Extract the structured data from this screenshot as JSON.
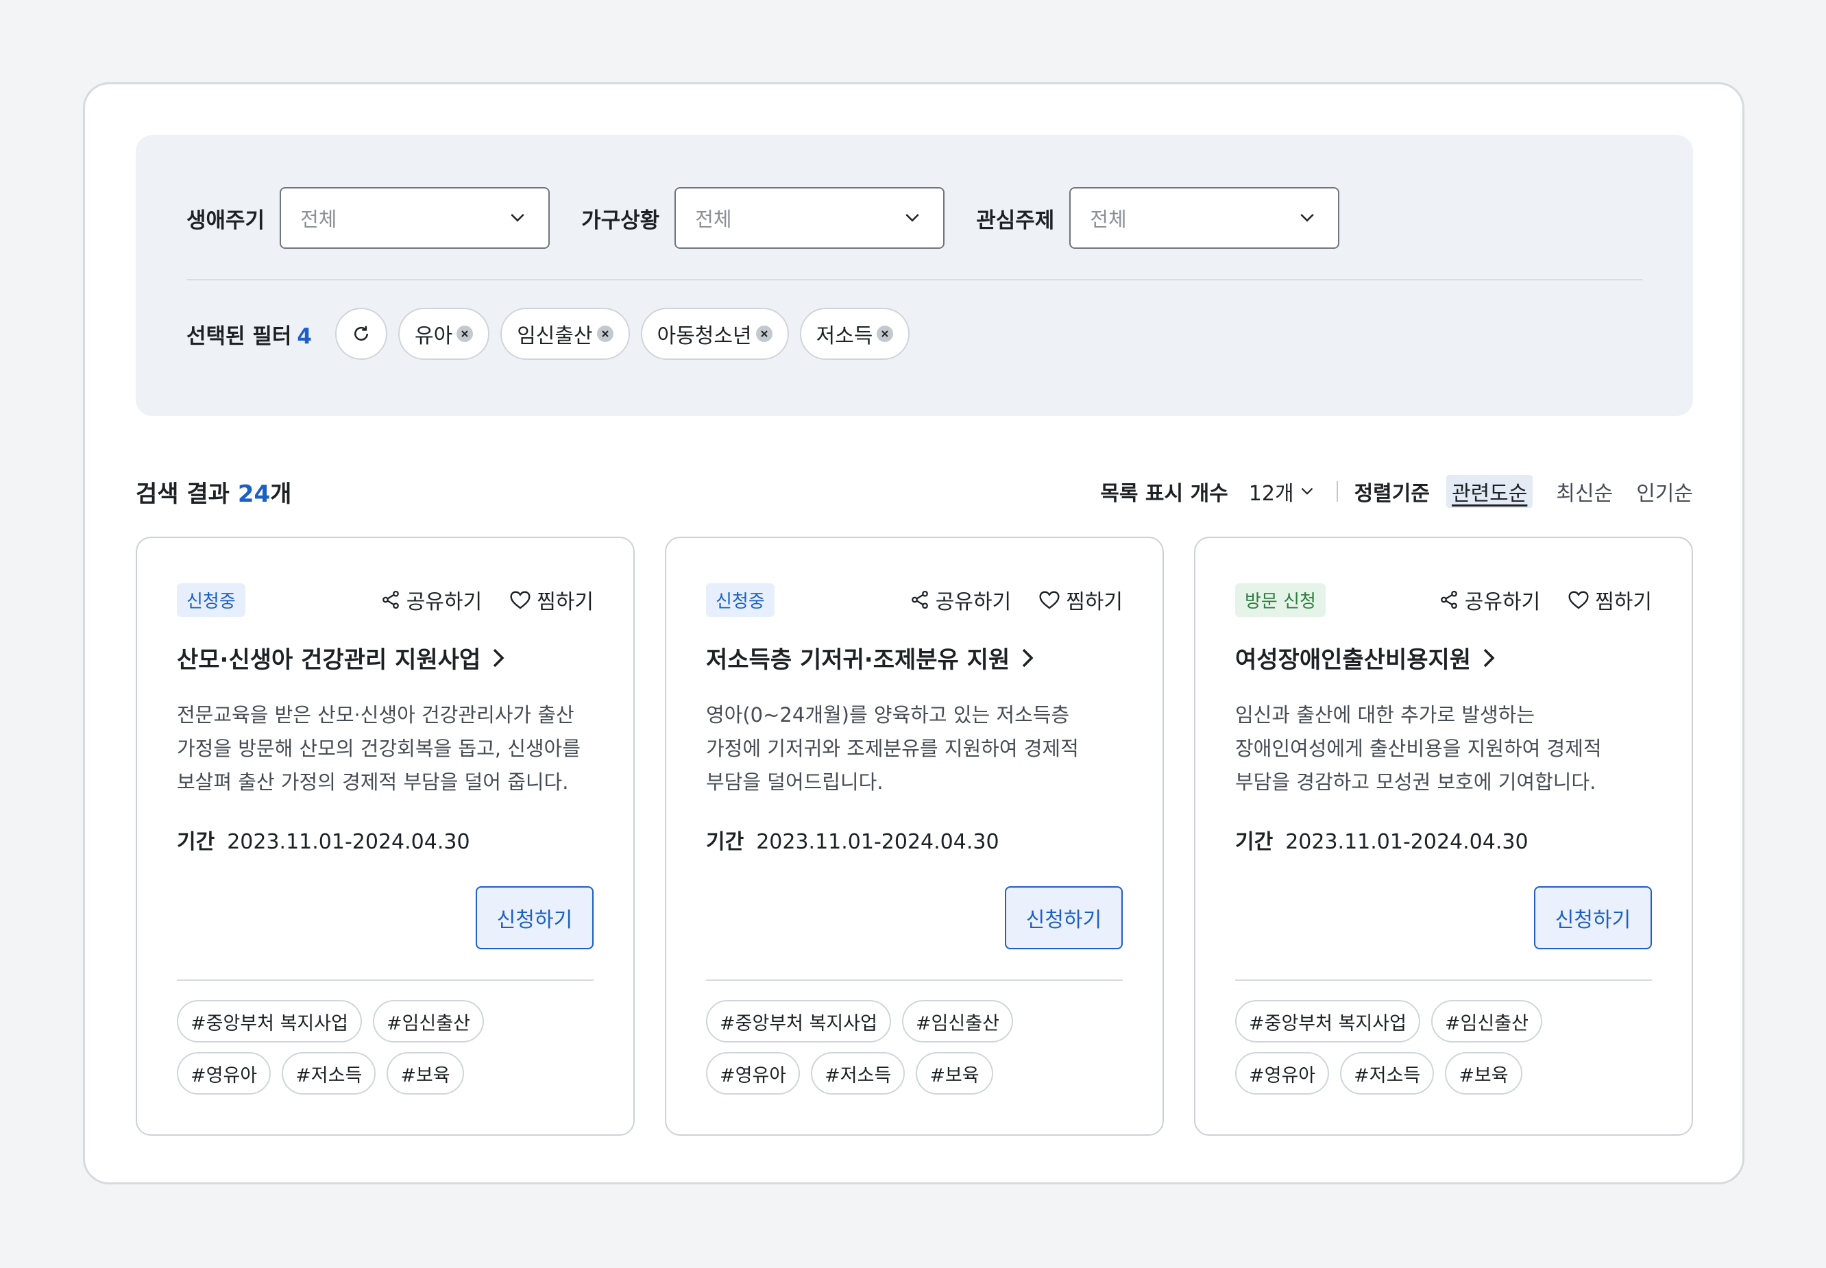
{
  "filters": {
    "groups": [
      {
        "label": "생애주기",
        "value": "전체"
      },
      {
        "label": "가구상황",
        "value": "전체"
      },
      {
        "label": "관심주제",
        "value": "전체"
      }
    ],
    "selected_label": "선택된 필터",
    "selected_count": "4",
    "chips": [
      "유아",
      "임신출산",
      "아동청소년",
      "저소득"
    ]
  },
  "results": {
    "prefix": "검색 결과",
    "count": "24",
    "suffix": "개",
    "per_page_label": "목록 표시 개수",
    "per_page_value": "12개",
    "sort_label": "정렬기준",
    "sort_options": [
      "관련도순",
      "최신순",
      "인기순"
    ],
    "sort_active": "관련도순"
  },
  "cards": [
    {
      "badge": "신청중",
      "badge_color": "#1d5fc4",
      "share": "공유하기",
      "bookmark": "찜하기",
      "title": "산모·신생아 건강관리 지원사업",
      "desc": "전문교육을 받은 산모·신생아 건강관리사가 출산 가정을 방문해 산모의 건강회복을 돕고, 신생아를 보살펴 출산 가정의 경제적 부담을 덜어 줍니다.",
      "period_label": "기간",
      "period": "2023.11.01-2024.04.30",
      "apply": "신청하기",
      "tags": [
        "#중앙부처 복지사업",
        "#임신출산",
        "#영유아",
        "#저소득",
        "#보육"
      ]
    },
    {
      "badge": "신청중",
      "badge_color": "#1d5fc4",
      "share": "공유하기",
      "bookmark": "찜하기",
      "title": "저소득층 기저귀·조제분유 지원",
      "desc": "영아(0~24개월)를 양육하고 있는 저소득층 가정에 기저귀와 조제분유를 지원하여 경제적 부담을 덜어드립니다.",
      "period_label": "기간",
      "period": "2023.11.01-2024.04.30",
      "apply": "신청하기",
      "tags": [
        "#중앙부처 복지사업",
        "#임신출산",
        "#영유아",
        "#저소득",
        "#보육"
      ]
    },
    {
      "badge": "방문 신청",
      "badge_color": "#2f7d3f",
      "share": "공유하기",
      "bookmark": "찜하기",
      "title": "여성장애인출산비용지원",
      "desc": "임신과 출산에 대한 추가로 발생하는 장애인여성에게 출산비용을 지원하여 경제적 부담을 경감하고 모성권 보호에 기여합니다.",
      "period_label": "기간",
      "period": "2023.11.01-2024.04.30",
      "apply": "신청하기",
      "tags": [
        "#중앙부처 복지사업",
        "#임신출산",
        "#영유아",
        "#저소득",
        "#보육"
      ]
    }
  ],
  "icons": {
    "chevron": "chevron-down-icon",
    "reset": "refresh-icon",
    "remove": "close-icon",
    "share": "share-icon",
    "heart": "heart-icon",
    "arrow": "chevron-right-icon"
  }
}
